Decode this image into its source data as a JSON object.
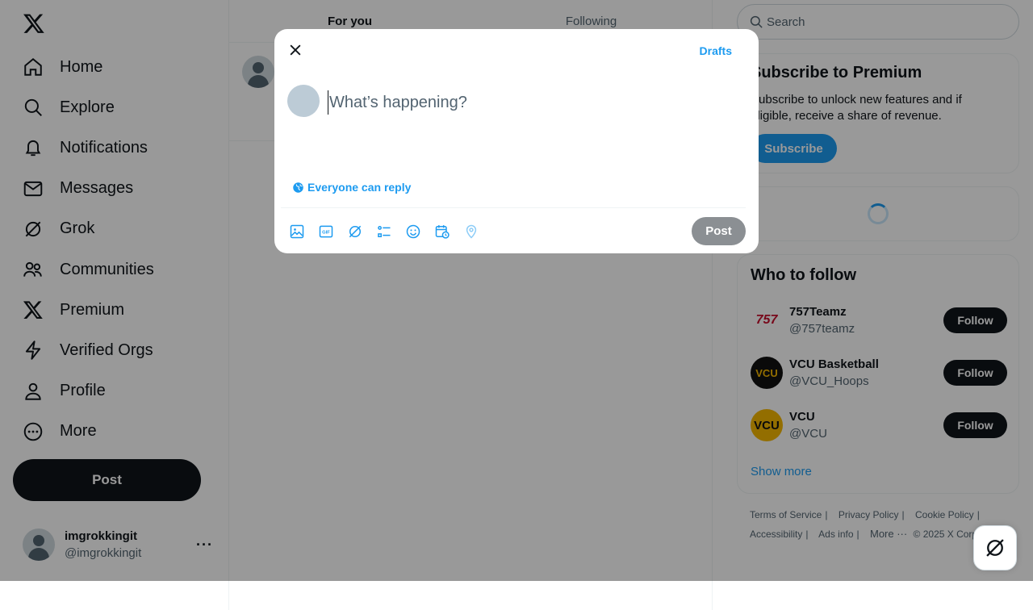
{
  "colors": {
    "accent": "#1d9bf0",
    "text": "#0f1419",
    "muted": "#536471"
  },
  "sidebar": {
    "logo_icon": "x-logo-icon",
    "items": [
      {
        "label": "Home",
        "icon": "home-icon"
      },
      {
        "label": "Explore",
        "icon": "search-icon"
      },
      {
        "label": "Notifications",
        "icon": "bell-icon"
      },
      {
        "label": "Messages",
        "icon": "envelope-icon"
      },
      {
        "label": "Grok",
        "icon": "grok-icon"
      },
      {
        "label": "Communities",
        "icon": "people-icon"
      },
      {
        "label": "Premium",
        "icon": "x-logo-icon"
      },
      {
        "label": "Verified Orgs",
        "icon": "lightning-icon"
      },
      {
        "label": "Profile",
        "icon": "person-icon"
      },
      {
        "label": "More",
        "icon": "more-circle-icon"
      }
    ],
    "post_label": "Post",
    "account": {
      "name": "imgrokkingit",
      "handle": "@imgrokkingit",
      "more": "···"
    }
  },
  "main": {
    "tabs": [
      {
        "label": "For you"
      },
      {
        "label": "Following"
      }
    ]
  },
  "right": {
    "search": {
      "placeholder": "Search"
    },
    "premium": {
      "title": "Subscribe to Premium",
      "body": "Subscribe to unlock new features and if eligible, receive a share of revenue.",
      "button": "Subscribe"
    },
    "who_to_follow": {
      "title": "Who to follow",
      "items": [
        {
          "name": "757Teamz",
          "handle": "@757teamz",
          "button": "Follow",
          "avatar_text": "757"
        },
        {
          "name": "VCU Basketball",
          "handle": "@VCU_Hoops",
          "button": "Follow",
          "avatar_text": "VCU"
        },
        {
          "name": "VCU",
          "handle": "@VCU",
          "button": "Follow",
          "avatar_text": "VCU"
        }
      ],
      "show_more": "Show more"
    },
    "footer": {
      "links": [
        "Terms of Service",
        "Privacy Policy",
        "Cookie Policy",
        "Accessibility",
        "Ads info"
      ],
      "more": "More ···",
      "copyright": "© 2025 X Corp."
    }
  },
  "modal": {
    "drafts": "Drafts",
    "placeholder": "What’s happening?",
    "reply_setting": "Everyone can reply",
    "tools": [
      "image-icon",
      "gif-icon",
      "grok-icon",
      "poll-icon",
      "emoji-icon",
      "schedule-icon",
      "location-icon"
    ],
    "post_label": "Post"
  }
}
